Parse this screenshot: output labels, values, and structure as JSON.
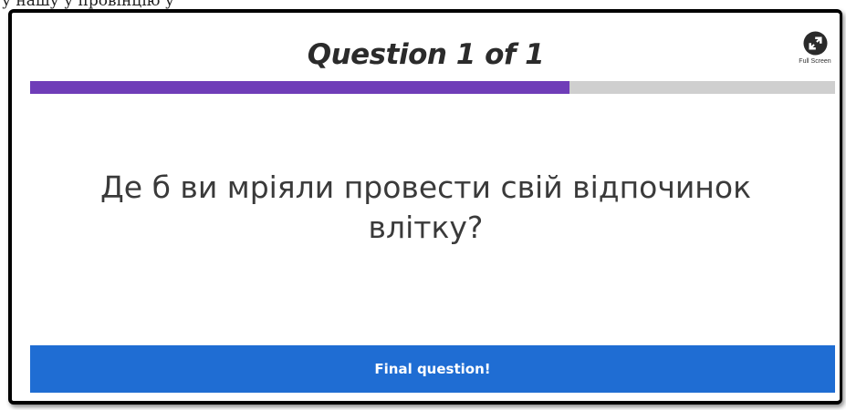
{
  "quiz": {
    "title": "Question 1 of 1",
    "question_text": "Де б ви мріяли провести свій відпочинок влітку?",
    "progress_fraction": 0.67,
    "full_screen_label": "Full Screen",
    "full_screen_icon": "expand-icon",
    "footer_text": "Final question!"
  },
  "top_strip": {
    "text": "у нашу у провінцію у"
  },
  "colors": {
    "progress_fill": "#6f3db8",
    "progress_track": "#cfcfcf",
    "footer_bar": "#1f6dd3",
    "title_text": "#2b2b2b"
  }
}
